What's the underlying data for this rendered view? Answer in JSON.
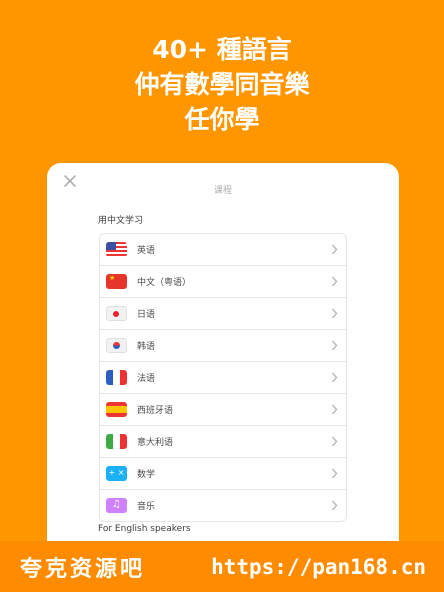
{
  "promo": {
    "line1": "40+ 種語言",
    "line2": "仲有數學同音樂",
    "line3": "任你學"
  },
  "screen": {
    "title": "课程",
    "section_chinese": "用中文学习",
    "section_english": "For English speakers",
    "courses": [
      {
        "label": "英语",
        "icon": "us-flag-icon"
      },
      {
        "label": "中文（粤语）",
        "icon": "china-flag-icon"
      },
      {
        "label": "日语",
        "icon": "japan-flag-icon"
      },
      {
        "label": "韩语",
        "icon": "korea-flag-icon"
      },
      {
        "label": "法语",
        "icon": "france-flag-icon"
      },
      {
        "label": "西班牙语",
        "icon": "spain-flag-icon"
      },
      {
        "label": "意大利语",
        "icon": "italy-flag-icon"
      },
      {
        "label": "数学",
        "icon": "math-icon"
      },
      {
        "label": "音乐",
        "icon": "music-icon"
      }
    ]
  },
  "watermark": {
    "left": "夸克资源吧",
    "right": "https://pan168.cn"
  },
  "colors": {
    "brand_orange": "#FF9600",
    "watermark_bg": "#FF8C00"
  }
}
